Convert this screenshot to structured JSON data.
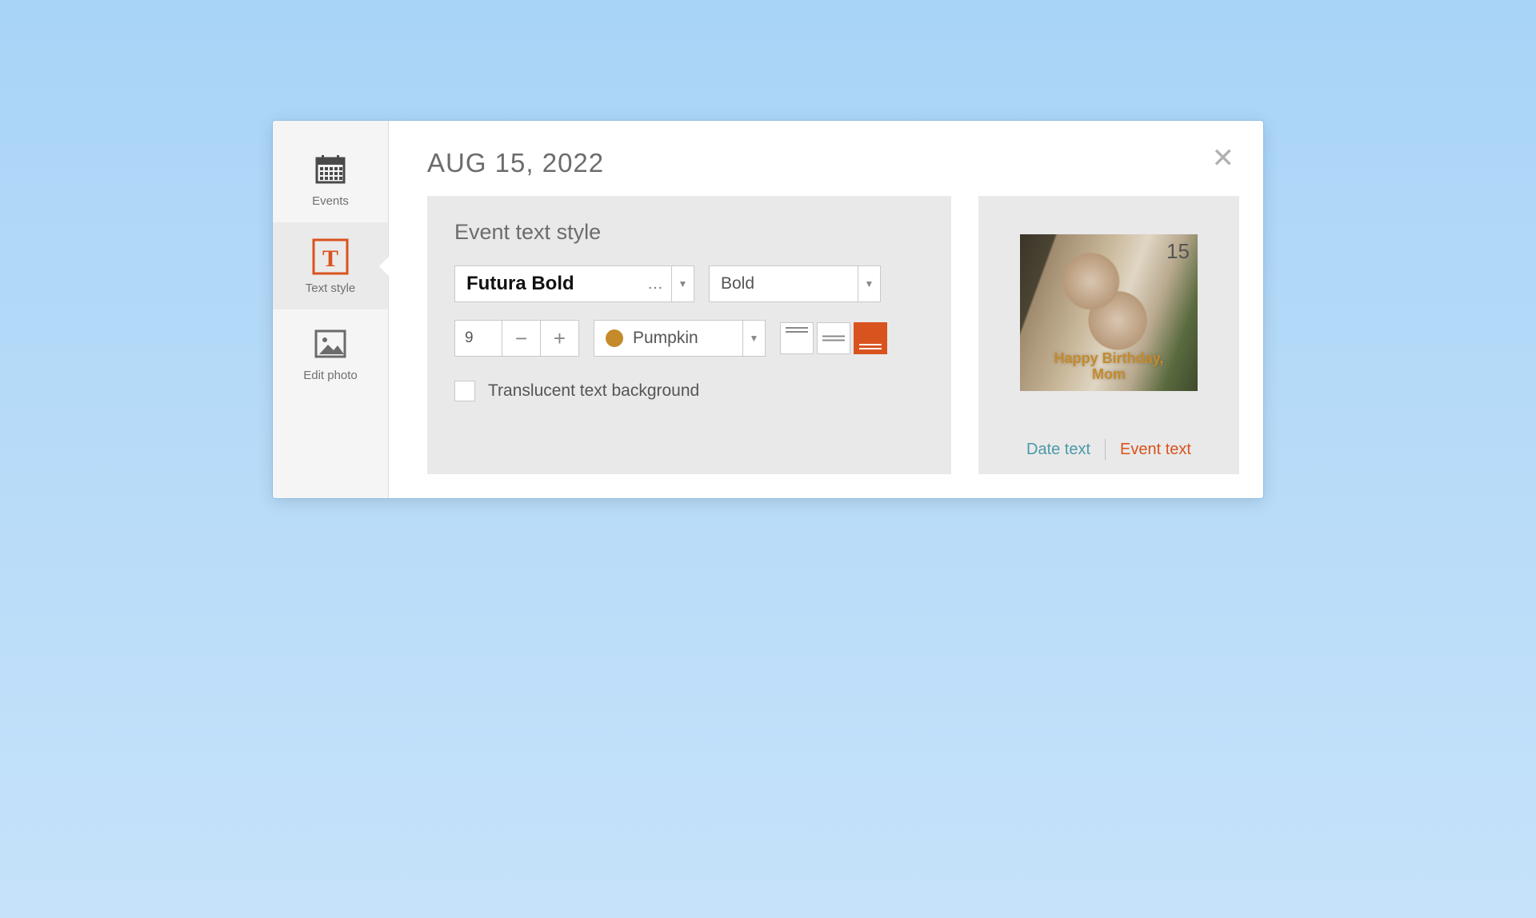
{
  "header": {
    "date_title": "AUG 15, 2022"
  },
  "sidebar": {
    "items": [
      {
        "label": "Events"
      },
      {
        "label": "Text style"
      },
      {
        "label": "Edit photo"
      }
    ],
    "active_index": 1
  },
  "panel": {
    "title": "Event text style",
    "font_family": "Futura Bold",
    "font_weight": "Bold",
    "font_size": "9",
    "color_name": "Pumpkin",
    "color_hex": "#c58a2a",
    "vertical_align": "bottom",
    "translucent_label": "Translucent text background",
    "translucent_checked": false
  },
  "preview": {
    "day_number": "15",
    "event_text_line1": "Happy Birthday,",
    "event_text_line2": "Mom",
    "tabs": {
      "date": "Date text",
      "event": "Event text"
    },
    "active_tab": "event"
  }
}
